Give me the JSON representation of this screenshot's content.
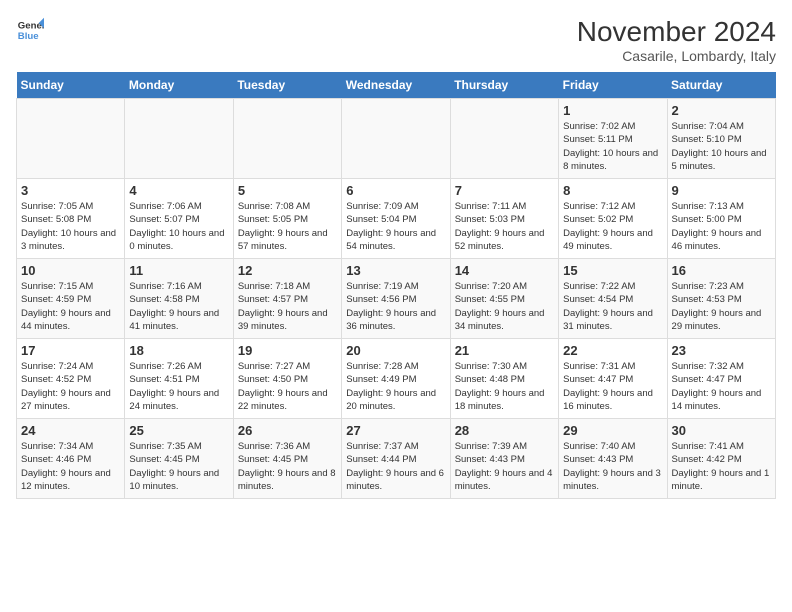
{
  "header": {
    "logo_line1": "General",
    "logo_line2": "Blue",
    "month_year": "November 2024",
    "location": "Casarile, Lombardy, Italy"
  },
  "weekdays": [
    "Sunday",
    "Monday",
    "Tuesday",
    "Wednesday",
    "Thursday",
    "Friday",
    "Saturday"
  ],
  "weeks": [
    [
      {
        "day": "",
        "info": ""
      },
      {
        "day": "",
        "info": ""
      },
      {
        "day": "",
        "info": ""
      },
      {
        "day": "",
        "info": ""
      },
      {
        "day": "",
        "info": ""
      },
      {
        "day": "1",
        "info": "Sunrise: 7:02 AM\nSunset: 5:11 PM\nDaylight: 10 hours and 8 minutes."
      },
      {
        "day": "2",
        "info": "Sunrise: 7:04 AM\nSunset: 5:10 PM\nDaylight: 10 hours and 5 minutes."
      }
    ],
    [
      {
        "day": "3",
        "info": "Sunrise: 7:05 AM\nSunset: 5:08 PM\nDaylight: 10 hours and 3 minutes."
      },
      {
        "day": "4",
        "info": "Sunrise: 7:06 AM\nSunset: 5:07 PM\nDaylight: 10 hours and 0 minutes."
      },
      {
        "day": "5",
        "info": "Sunrise: 7:08 AM\nSunset: 5:05 PM\nDaylight: 9 hours and 57 minutes."
      },
      {
        "day": "6",
        "info": "Sunrise: 7:09 AM\nSunset: 5:04 PM\nDaylight: 9 hours and 54 minutes."
      },
      {
        "day": "7",
        "info": "Sunrise: 7:11 AM\nSunset: 5:03 PM\nDaylight: 9 hours and 52 minutes."
      },
      {
        "day": "8",
        "info": "Sunrise: 7:12 AM\nSunset: 5:02 PM\nDaylight: 9 hours and 49 minutes."
      },
      {
        "day": "9",
        "info": "Sunrise: 7:13 AM\nSunset: 5:00 PM\nDaylight: 9 hours and 46 minutes."
      }
    ],
    [
      {
        "day": "10",
        "info": "Sunrise: 7:15 AM\nSunset: 4:59 PM\nDaylight: 9 hours and 44 minutes."
      },
      {
        "day": "11",
        "info": "Sunrise: 7:16 AM\nSunset: 4:58 PM\nDaylight: 9 hours and 41 minutes."
      },
      {
        "day": "12",
        "info": "Sunrise: 7:18 AM\nSunset: 4:57 PM\nDaylight: 9 hours and 39 minutes."
      },
      {
        "day": "13",
        "info": "Sunrise: 7:19 AM\nSunset: 4:56 PM\nDaylight: 9 hours and 36 minutes."
      },
      {
        "day": "14",
        "info": "Sunrise: 7:20 AM\nSunset: 4:55 PM\nDaylight: 9 hours and 34 minutes."
      },
      {
        "day": "15",
        "info": "Sunrise: 7:22 AM\nSunset: 4:54 PM\nDaylight: 9 hours and 31 minutes."
      },
      {
        "day": "16",
        "info": "Sunrise: 7:23 AM\nSunset: 4:53 PM\nDaylight: 9 hours and 29 minutes."
      }
    ],
    [
      {
        "day": "17",
        "info": "Sunrise: 7:24 AM\nSunset: 4:52 PM\nDaylight: 9 hours and 27 minutes."
      },
      {
        "day": "18",
        "info": "Sunrise: 7:26 AM\nSunset: 4:51 PM\nDaylight: 9 hours and 24 minutes."
      },
      {
        "day": "19",
        "info": "Sunrise: 7:27 AM\nSunset: 4:50 PM\nDaylight: 9 hours and 22 minutes."
      },
      {
        "day": "20",
        "info": "Sunrise: 7:28 AM\nSunset: 4:49 PM\nDaylight: 9 hours and 20 minutes."
      },
      {
        "day": "21",
        "info": "Sunrise: 7:30 AM\nSunset: 4:48 PM\nDaylight: 9 hours and 18 minutes."
      },
      {
        "day": "22",
        "info": "Sunrise: 7:31 AM\nSunset: 4:47 PM\nDaylight: 9 hours and 16 minutes."
      },
      {
        "day": "23",
        "info": "Sunrise: 7:32 AM\nSunset: 4:47 PM\nDaylight: 9 hours and 14 minutes."
      }
    ],
    [
      {
        "day": "24",
        "info": "Sunrise: 7:34 AM\nSunset: 4:46 PM\nDaylight: 9 hours and 12 minutes."
      },
      {
        "day": "25",
        "info": "Sunrise: 7:35 AM\nSunset: 4:45 PM\nDaylight: 9 hours and 10 minutes."
      },
      {
        "day": "26",
        "info": "Sunrise: 7:36 AM\nSunset: 4:45 PM\nDaylight: 9 hours and 8 minutes."
      },
      {
        "day": "27",
        "info": "Sunrise: 7:37 AM\nSunset: 4:44 PM\nDaylight: 9 hours and 6 minutes."
      },
      {
        "day": "28",
        "info": "Sunrise: 7:39 AM\nSunset: 4:43 PM\nDaylight: 9 hours and 4 minutes."
      },
      {
        "day": "29",
        "info": "Sunrise: 7:40 AM\nSunset: 4:43 PM\nDaylight: 9 hours and 3 minutes."
      },
      {
        "day": "30",
        "info": "Sunrise: 7:41 AM\nSunset: 4:42 PM\nDaylight: 9 hours and 1 minute."
      }
    ]
  ]
}
